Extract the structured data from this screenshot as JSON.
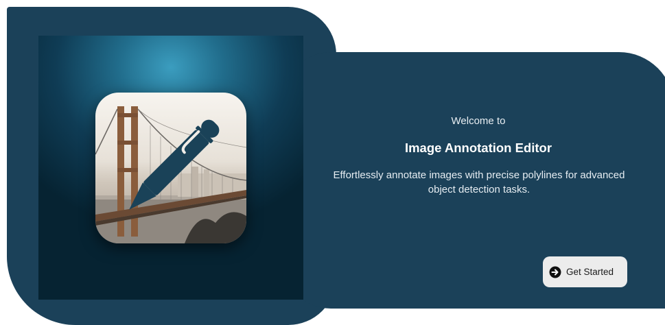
{
  "welcome": {
    "greeting": "Welcome to",
    "title": "Image Annotation Editor",
    "description": "Effortlessly annotate images with precise polylines for advanced object detection tasks.",
    "cta_label": "Get Started",
    "cta_icon": "arrow-circle-right-icon"
  },
  "hero": {
    "app_icon": "pen-over-bridge-icon"
  },
  "colors": {
    "panel": "#1b4159",
    "hero_glow": "#3b9dbf",
    "button_bg": "#ececec",
    "pen": "#1a4258"
  }
}
